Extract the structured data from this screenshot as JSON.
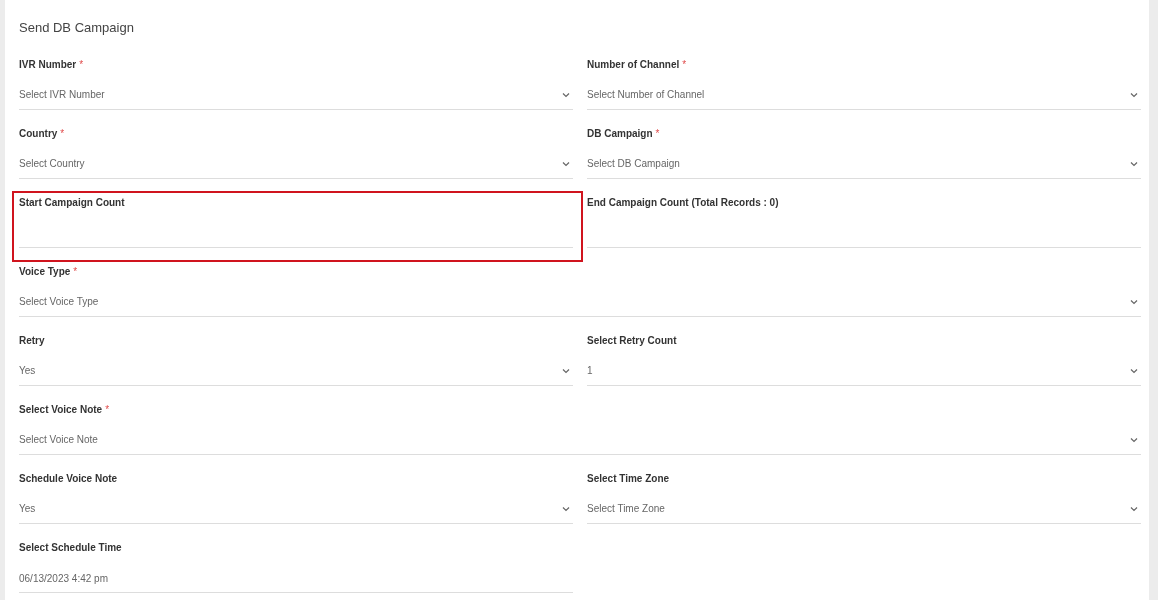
{
  "form": {
    "title": "Send DB Campaign",
    "rows": [
      {
        "fields": [
          {
            "label": "IVR Number",
            "required_mark": "*",
            "kind": "select",
            "placeholder": "Select IVR Number",
            "wide": false
          },
          {
            "label": "Number of Channel",
            "required_mark": "*",
            "kind": "select",
            "placeholder": "Select Number of Channel",
            "wide": false
          }
        ]
      },
      {
        "fields": [
          {
            "label": "Country",
            "required_mark": "*",
            "kind": "select",
            "placeholder": "Select Country",
            "wide": false
          },
          {
            "label": "DB Campaign",
            "required_mark": "*",
            "kind": "select",
            "placeholder": "Select DB Campaign",
            "wide": false
          }
        ]
      },
      {
        "fields": [
          {
            "label": "Start Campaign Count",
            "kind": "text",
            "wide": false,
            "highlighted": true
          },
          {
            "label": "End Campaign Count (Total Records : 0)",
            "kind": "text",
            "wide": false
          }
        ]
      },
      {
        "fields": [
          {
            "label": "Voice Type",
            "required_mark": "*",
            "kind": "select",
            "placeholder": "Select Voice Type",
            "wide": true
          }
        ]
      },
      {
        "fields": [
          {
            "label": "Retry",
            "kind": "select",
            "value": "Yes",
            "wide": false
          },
          {
            "label": "Select Retry Count",
            "kind": "select",
            "value": "1",
            "wide": false
          }
        ]
      },
      {
        "fields": [
          {
            "label": "Select Voice Note",
            "required_mark": "*",
            "kind": "select",
            "placeholder": "Select Voice Note",
            "wide": true
          }
        ]
      },
      {
        "fields": [
          {
            "label": "Schedule Voice Note",
            "kind": "select",
            "value": "Yes",
            "wide": false
          },
          {
            "label": "Select Time Zone",
            "kind": "select",
            "placeholder": "Select Time Zone",
            "wide": false
          }
        ]
      },
      {
        "fields": [
          {
            "label": "Select Schedule Time",
            "kind": "text",
            "value": "06/13/2023 4:42 pm",
            "wide": false
          }
        ]
      }
    ]
  }
}
